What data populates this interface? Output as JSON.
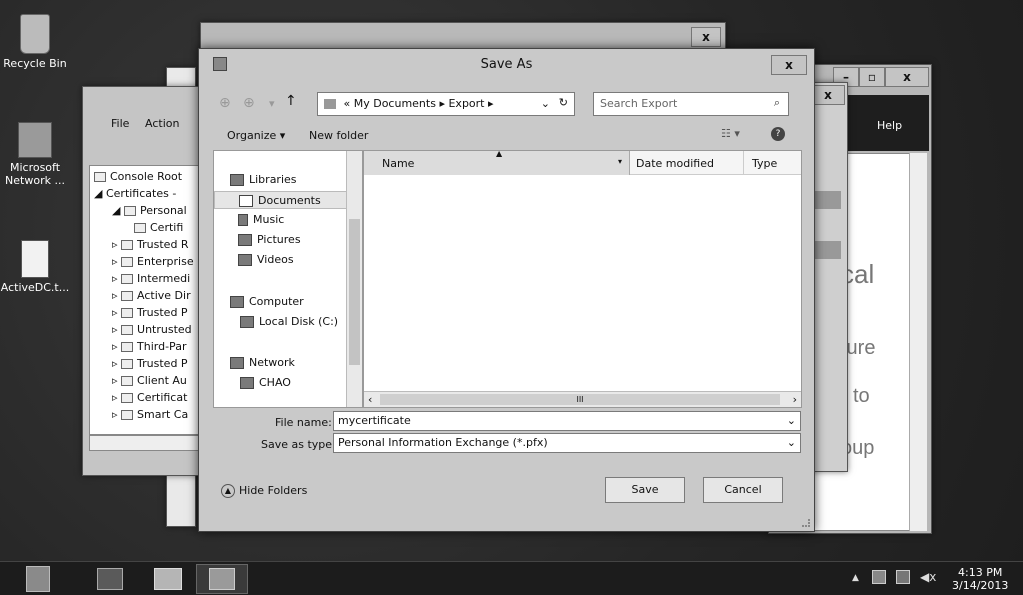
{
  "desktop": {
    "icons": [
      {
        "label": "Recycle Bin",
        "icon": "recycle-bin-icon"
      },
      {
        "label": "Microsoft Network ...",
        "icon": "network-shortcut-icon"
      },
      {
        "label": "ActiveDC.t...",
        "icon": "text-file-icon"
      }
    ]
  },
  "mmc": {
    "menu": [
      "File",
      "Action"
    ],
    "tree": [
      {
        "label": "Console Root"
      },
      {
        "label": "Certificates -"
      },
      {
        "label": "Personal"
      },
      {
        "label": "Certifi"
      },
      {
        "label": "Trusted R"
      },
      {
        "label": "Enterprise"
      },
      {
        "label": "Intermedi"
      },
      {
        "label": "Active Dir"
      },
      {
        "label": "Trusted P"
      },
      {
        "label": "Untrusted"
      },
      {
        "label": "Third-Par"
      },
      {
        "label": "Trusted P"
      },
      {
        "label": "Client Au"
      },
      {
        "label": "Certificat"
      },
      {
        "label": "Smart Ca"
      }
    ]
  },
  "rightwin": {
    "help": "Help",
    "fragments": [
      "cal",
      "ture",
      "to",
      "oup"
    ]
  },
  "saveas": {
    "title": "Save As",
    "close": "x",
    "breadcrumb": [
      "«",
      "My Documents",
      "▸",
      "Export",
      "▸"
    ],
    "search_placeholder": "Search Export",
    "organize": "Organize ▾",
    "new_folder": "New folder",
    "nav_tree": [
      {
        "label": "Libraries",
        "icon": "libraries-icon"
      },
      {
        "label": "Documents",
        "icon": "documents-icon"
      },
      {
        "label": "Music",
        "icon": "music-icon"
      },
      {
        "label": "Pictures",
        "icon": "pictures-icon"
      },
      {
        "label": "Videos",
        "icon": "videos-icon"
      },
      {
        "label": "Computer",
        "icon": "computer-icon"
      },
      {
        "label": "Local Disk (C:)",
        "icon": "disk-icon"
      },
      {
        "label": "Network",
        "icon": "network-icon"
      },
      {
        "label": "CHAO",
        "icon": "computer-icon"
      }
    ],
    "columns": [
      "Name",
      "Date modified",
      "Type"
    ],
    "scroll_mid": "III",
    "filename_label": "File name:",
    "filename_value": "mycertificate",
    "savetype_label": "Save as type:",
    "savetype_value": "Personal Information Exchange (*.pfx)",
    "hide_folders": "Hide Folders",
    "save": "Save",
    "cancel": "Cancel"
  },
  "back_dialog": {
    "close": "x"
  },
  "taskbar": {
    "time": "4:13 PM",
    "date": "3/14/2013"
  }
}
